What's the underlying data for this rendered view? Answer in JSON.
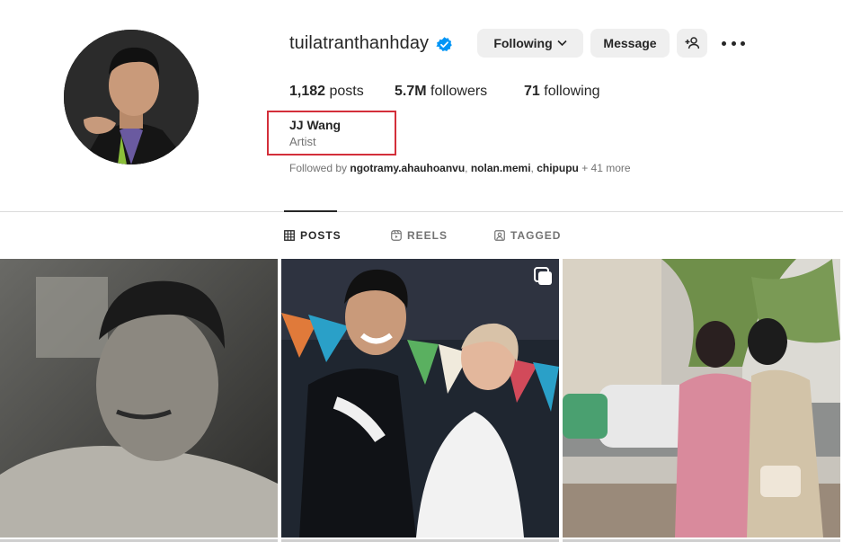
{
  "profile": {
    "username": "tuilatranthanhday",
    "verified": true,
    "avatar_icon": "profile-photo"
  },
  "actions": {
    "following_label": "Following",
    "message_label": "Message",
    "add_user_icon": "add-user-icon",
    "more_icon": "more-horizontal-icon"
  },
  "stats": {
    "posts_count": "1,182",
    "posts_label": "posts",
    "followers_count": "5.7M",
    "followers_label": "followers",
    "following_count": "71",
    "following_label": "following"
  },
  "bio": {
    "name": "JJ Wang",
    "category": "Artist",
    "highlight_color": "#d32f3a"
  },
  "followed_by": {
    "prefix": "Followed by ",
    "users": [
      "ngotramy.ahauhoanvu",
      "nolan.memi",
      "chipupu"
    ],
    "separator": ", ",
    "more": " + 41 more"
  },
  "tabs": [
    {
      "label": "POSTS",
      "icon": "grid-icon",
      "active": true
    },
    {
      "label": "REELS",
      "icon": "reels-icon",
      "active": false
    },
    {
      "label": "TAGGED",
      "icon": "tagged-icon",
      "active": false
    }
  ],
  "posts": [
    {
      "kind": "photo",
      "description_icon": "bw-portrait"
    },
    {
      "kind": "carousel",
      "description_icon": "wedding-couple",
      "badge_icon": "carousel-icon"
    },
    {
      "kind": "photo",
      "description_icon": "street-couple"
    }
  ],
  "colors": {
    "verified_blue": "#0095f6",
    "button_bg": "#efefef",
    "text_secondary": "#737373"
  }
}
